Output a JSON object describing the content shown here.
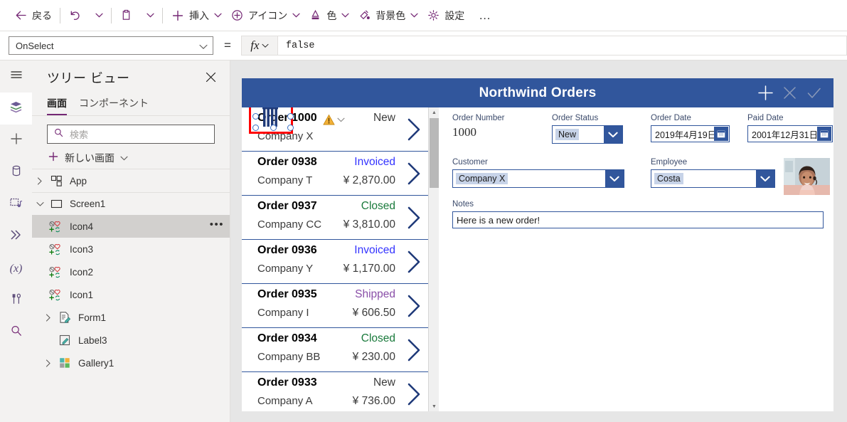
{
  "toolbar": {
    "items": [
      {
        "name": "back",
        "icon": "arrow-left-icon",
        "label": "戻る",
        "chevron": false
      },
      {
        "name": "undo",
        "icon": "undo-icon",
        "label": "",
        "chevron": false
      },
      {
        "name": "undo-more",
        "icon": "",
        "label": "",
        "chevron": true
      },
      {
        "name": "paste",
        "icon": "clipboard-icon",
        "label": "",
        "chevron": false
      },
      {
        "name": "paste-more",
        "icon": "",
        "label": "",
        "chevron": true
      },
      {
        "name": "insert",
        "icon": "plus-icon",
        "label": "挿入",
        "chevron": true
      },
      {
        "name": "icons",
        "icon": "circle-plus-icon",
        "label": "アイコン",
        "chevron": true
      },
      {
        "name": "color",
        "icon": "color-fill-icon",
        "label": "色",
        "chevron": true
      },
      {
        "name": "background-color",
        "icon": "background-color-icon",
        "label": "背景色",
        "chevron": true
      },
      {
        "name": "settings",
        "icon": "gear-icon",
        "label": "設定",
        "chevron": false
      }
    ],
    "overflow_label": "…",
    "accent": "#742774"
  },
  "formula_bar": {
    "property": "OnSelect",
    "equals": "=",
    "fx_label": "fx",
    "expression": "false"
  },
  "rail": {
    "items": [
      {
        "name": "hamburger-icon",
        "label": "メニュー",
        "active": false
      },
      {
        "name": "tree-view-icon",
        "label": "ツリー ビュー",
        "active": true
      },
      {
        "name": "insert-icon",
        "label": "挿入",
        "active": false
      },
      {
        "name": "data-icon",
        "label": "データ",
        "active": false
      },
      {
        "name": "media-icon",
        "label": "メディア",
        "active": false
      },
      {
        "name": "advanced-icon",
        "label": "詳細",
        "active": false
      },
      {
        "name": "variables-icon",
        "label": "(x)",
        "active": false
      },
      {
        "name": "tools-icon",
        "label": "ツール",
        "active": false
      },
      {
        "name": "search-icon",
        "label": "検索",
        "active": false
      }
    ]
  },
  "tree_view": {
    "title": "ツリー ビュー",
    "close_label": "×",
    "tabs": [
      {
        "label": "画面",
        "selected": true
      },
      {
        "label": "コンポーネント",
        "selected": false
      }
    ],
    "search_placeholder": "検索",
    "new_screen_label": "新しい画面",
    "nodes": [
      {
        "label": "App",
        "icon": "app-icon",
        "twisty": "collapsed",
        "indent": 0,
        "selected": false,
        "more": false
      },
      {
        "label": "Screen1",
        "icon": "screen-icon",
        "twisty": "expanded",
        "indent": 0,
        "selected": false,
        "more": false
      },
      {
        "label": "Icon4",
        "icon": "icon-control-icon",
        "twisty": "none",
        "indent": 1,
        "selected": true,
        "more": true
      },
      {
        "label": "Icon3",
        "icon": "icon-control-icon",
        "twisty": "none",
        "indent": 1,
        "selected": false,
        "more": false
      },
      {
        "label": "Icon2",
        "icon": "icon-control-icon",
        "twisty": "none",
        "indent": 1,
        "selected": false,
        "more": false
      },
      {
        "label": "Icon1",
        "icon": "icon-control-icon",
        "twisty": "none",
        "indent": 1,
        "selected": false,
        "more": false
      },
      {
        "label": "Form1",
        "icon": "form-icon",
        "twisty": "collapsed",
        "indent": 1,
        "selected": false,
        "more": false
      },
      {
        "label": "Label3",
        "icon": "label-icon",
        "twisty": "none",
        "indent": 1,
        "selected": false,
        "more": false
      },
      {
        "label": "Gallery1",
        "icon": "gallery-icon",
        "twisty": "collapsed",
        "indent": 1,
        "selected": false,
        "more": false
      }
    ]
  },
  "app": {
    "header": {
      "title": "Northwind Orders",
      "background": "#31569c",
      "icons": [
        {
          "name": "add-icon",
          "glyph": "+",
          "enabled": true
        },
        {
          "name": "cancel-icon",
          "glyph": "×",
          "enabled": false
        },
        {
          "name": "check-icon",
          "glyph": "✓",
          "enabled": false
        }
      ]
    },
    "gallery": {
      "rows": [
        {
          "order": "Order 1000",
          "company": "Company X",
          "status": "New",
          "status_color": "#3b3b3b",
          "amount": "",
          "warning": true,
          "selected_control": true
        },
        {
          "order": "Order 0938",
          "company": "Company T",
          "status": "Invoiced",
          "status_color": "#3333ff",
          "amount": "¥ 2,870.00",
          "warning": false,
          "selected_control": false
        },
        {
          "order": "Order 0937",
          "company": "Company CC",
          "status": "Closed",
          "status_color": "#1a7a3c",
          "amount": "¥ 3,810.00",
          "warning": false,
          "selected_control": false
        },
        {
          "order": "Order 0936",
          "company": "Company Y",
          "status": "Invoiced",
          "status_color": "#3333ff",
          "amount": "¥ 1,170.00",
          "warning": false,
          "selected_control": false
        },
        {
          "order": "Order 0935",
          "company": "Company I",
          "status": "Shipped",
          "status_color": "#8a4fa8",
          "amount": "¥ 606.50",
          "warning": false,
          "selected_control": false
        },
        {
          "order": "Order 0934",
          "company": "Company BB",
          "status": "Closed",
          "status_color": "#1a7a3c",
          "amount": "¥ 230.00",
          "warning": false,
          "selected_control": false
        },
        {
          "order": "Order 0933",
          "company": "Company A",
          "status": "New",
          "status_color": "#3b3b3b",
          "amount": "¥ 736.00",
          "warning": false,
          "selected_control": false
        }
      ],
      "scrollbar": {
        "thumb_position": "top"
      }
    },
    "form": {
      "fields": {
        "order_number": {
          "label": "Order Number",
          "value": "1000"
        },
        "order_status": {
          "label": "Order Status",
          "value": "New"
        },
        "order_date": {
          "label": "Order Date",
          "value": "2019年4月19日"
        },
        "paid_date": {
          "label": "Paid Date",
          "value": "2001年12月31日"
        },
        "customer": {
          "label": "Customer",
          "value": "Company X"
        },
        "employee": {
          "label": "Employee",
          "value": "Costa"
        },
        "notes": {
          "label": "Notes",
          "value": "Here is a new order!"
        }
      },
      "employee_photo_alt": "employee-photo"
    }
  },
  "selection": {
    "control": "Icon4",
    "border_color": "#ff0000",
    "handle_color": "#3a6fc4"
  }
}
